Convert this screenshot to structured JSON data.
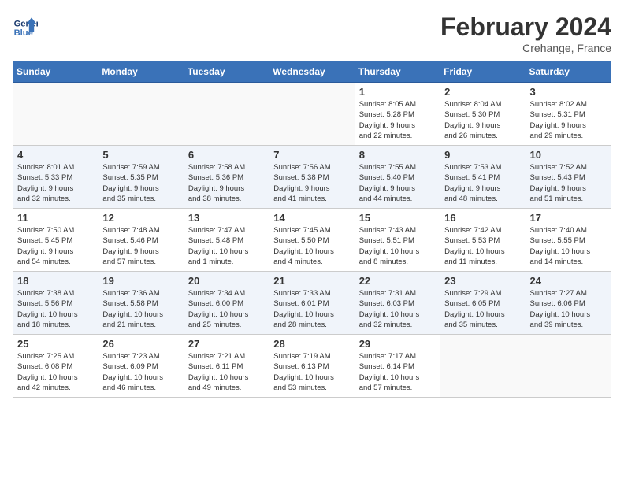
{
  "header": {
    "logo_line1": "General",
    "logo_line2": "Blue",
    "month_title": "February 2024",
    "location": "Crehange, France"
  },
  "days_of_week": [
    "Sunday",
    "Monday",
    "Tuesday",
    "Wednesday",
    "Thursday",
    "Friday",
    "Saturday"
  ],
  "weeks": [
    {
      "shaded": false,
      "days": [
        {
          "number": "",
          "info": ""
        },
        {
          "number": "",
          "info": ""
        },
        {
          "number": "",
          "info": ""
        },
        {
          "number": "",
          "info": ""
        },
        {
          "number": "1",
          "info": "Sunrise: 8:05 AM\nSunset: 5:28 PM\nDaylight: 9 hours\nand 22 minutes."
        },
        {
          "number": "2",
          "info": "Sunrise: 8:04 AM\nSunset: 5:30 PM\nDaylight: 9 hours\nand 26 minutes."
        },
        {
          "number": "3",
          "info": "Sunrise: 8:02 AM\nSunset: 5:31 PM\nDaylight: 9 hours\nand 29 minutes."
        }
      ]
    },
    {
      "shaded": true,
      "days": [
        {
          "number": "4",
          "info": "Sunrise: 8:01 AM\nSunset: 5:33 PM\nDaylight: 9 hours\nand 32 minutes."
        },
        {
          "number": "5",
          "info": "Sunrise: 7:59 AM\nSunset: 5:35 PM\nDaylight: 9 hours\nand 35 minutes."
        },
        {
          "number": "6",
          "info": "Sunrise: 7:58 AM\nSunset: 5:36 PM\nDaylight: 9 hours\nand 38 minutes."
        },
        {
          "number": "7",
          "info": "Sunrise: 7:56 AM\nSunset: 5:38 PM\nDaylight: 9 hours\nand 41 minutes."
        },
        {
          "number": "8",
          "info": "Sunrise: 7:55 AM\nSunset: 5:40 PM\nDaylight: 9 hours\nand 44 minutes."
        },
        {
          "number": "9",
          "info": "Sunrise: 7:53 AM\nSunset: 5:41 PM\nDaylight: 9 hours\nand 48 minutes."
        },
        {
          "number": "10",
          "info": "Sunrise: 7:52 AM\nSunset: 5:43 PM\nDaylight: 9 hours\nand 51 minutes."
        }
      ]
    },
    {
      "shaded": false,
      "days": [
        {
          "number": "11",
          "info": "Sunrise: 7:50 AM\nSunset: 5:45 PM\nDaylight: 9 hours\nand 54 minutes."
        },
        {
          "number": "12",
          "info": "Sunrise: 7:48 AM\nSunset: 5:46 PM\nDaylight: 9 hours\nand 57 minutes."
        },
        {
          "number": "13",
          "info": "Sunrise: 7:47 AM\nSunset: 5:48 PM\nDaylight: 10 hours\nand 1 minute."
        },
        {
          "number": "14",
          "info": "Sunrise: 7:45 AM\nSunset: 5:50 PM\nDaylight: 10 hours\nand 4 minutes."
        },
        {
          "number": "15",
          "info": "Sunrise: 7:43 AM\nSunset: 5:51 PM\nDaylight: 10 hours\nand 8 minutes."
        },
        {
          "number": "16",
          "info": "Sunrise: 7:42 AM\nSunset: 5:53 PM\nDaylight: 10 hours\nand 11 minutes."
        },
        {
          "number": "17",
          "info": "Sunrise: 7:40 AM\nSunset: 5:55 PM\nDaylight: 10 hours\nand 14 minutes."
        }
      ]
    },
    {
      "shaded": true,
      "days": [
        {
          "number": "18",
          "info": "Sunrise: 7:38 AM\nSunset: 5:56 PM\nDaylight: 10 hours\nand 18 minutes."
        },
        {
          "number": "19",
          "info": "Sunrise: 7:36 AM\nSunset: 5:58 PM\nDaylight: 10 hours\nand 21 minutes."
        },
        {
          "number": "20",
          "info": "Sunrise: 7:34 AM\nSunset: 6:00 PM\nDaylight: 10 hours\nand 25 minutes."
        },
        {
          "number": "21",
          "info": "Sunrise: 7:33 AM\nSunset: 6:01 PM\nDaylight: 10 hours\nand 28 minutes."
        },
        {
          "number": "22",
          "info": "Sunrise: 7:31 AM\nSunset: 6:03 PM\nDaylight: 10 hours\nand 32 minutes."
        },
        {
          "number": "23",
          "info": "Sunrise: 7:29 AM\nSunset: 6:05 PM\nDaylight: 10 hours\nand 35 minutes."
        },
        {
          "number": "24",
          "info": "Sunrise: 7:27 AM\nSunset: 6:06 PM\nDaylight: 10 hours\nand 39 minutes."
        }
      ]
    },
    {
      "shaded": false,
      "days": [
        {
          "number": "25",
          "info": "Sunrise: 7:25 AM\nSunset: 6:08 PM\nDaylight: 10 hours\nand 42 minutes."
        },
        {
          "number": "26",
          "info": "Sunrise: 7:23 AM\nSunset: 6:09 PM\nDaylight: 10 hours\nand 46 minutes."
        },
        {
          "number": "27",
          "info": "Sunrise: 7:21 AM\nSunset: 6:11 PM\nDaylight: 10 hours\nand 49 minutes."
        },
        {
          "number": "28",
          "info": "Sunrise: 7:19 AM\nSunset: 6:13 PM\nDaylight: 10 hours\nand 53 minutes."
        },
        {
          "number": "29",
          "info": "Sunrise: 7:17 AM\nSunset: 6:14 PM\nDaylight: 10 hours\nand 57 minutes."
        },
        {
          "number": "",
          "info": ""
        },
        {
          "number": "",
          "info": ""
        }
      ]
    }
  ]
}
